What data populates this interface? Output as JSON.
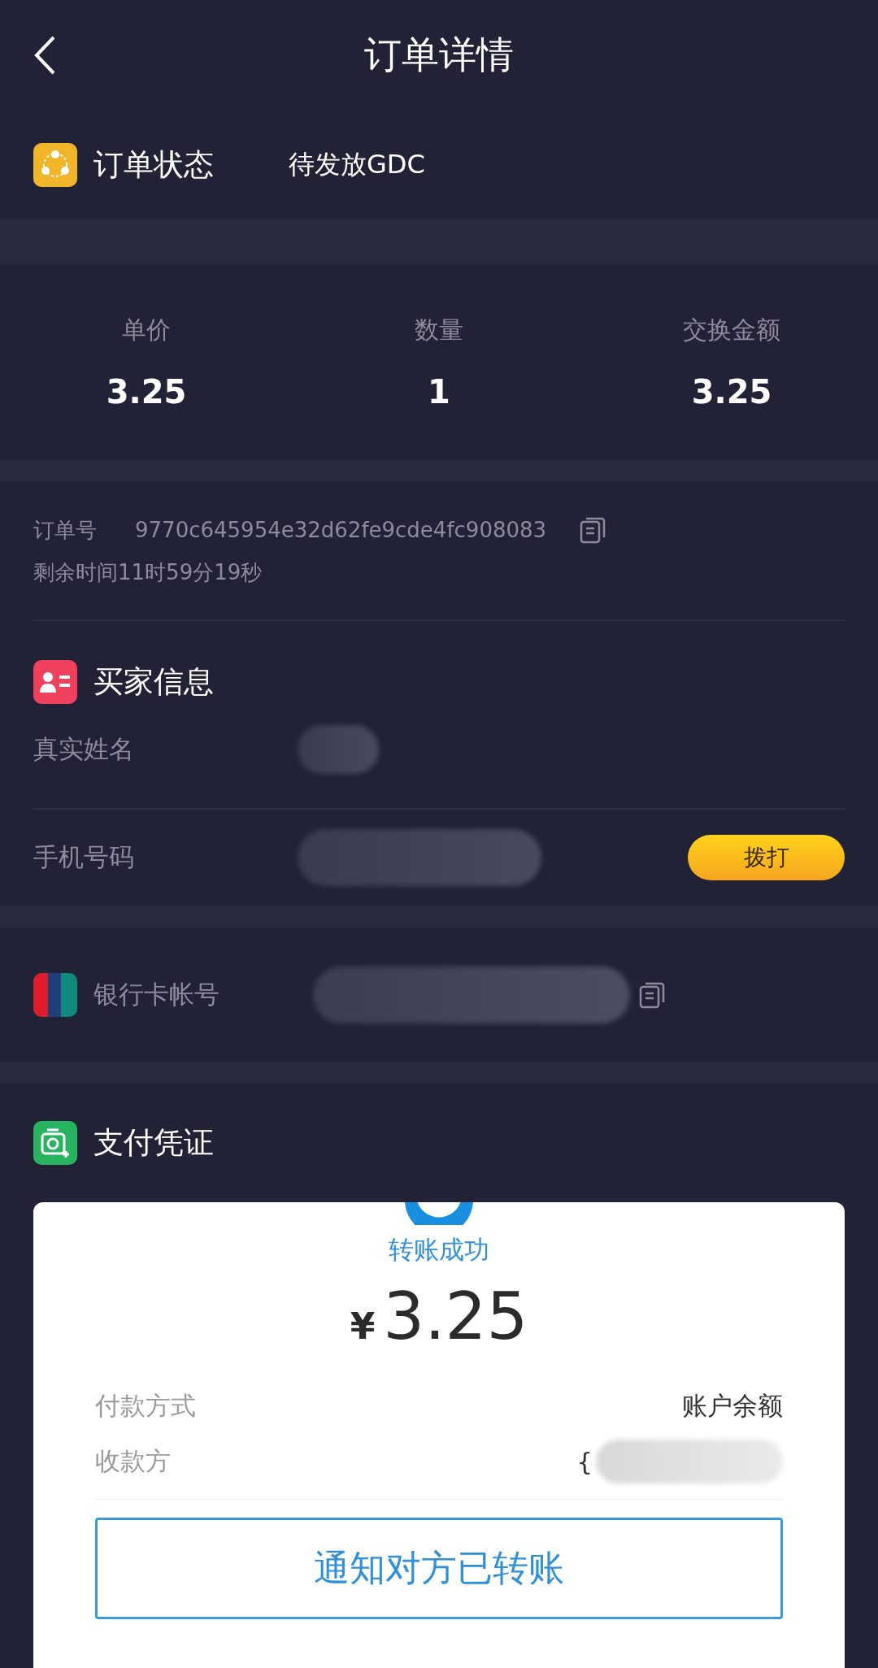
{
  "header": {
    "title": "订单详情"
  },
  "status": {
    "label": "订单状态",
    "value": "待发放GDC"
  },
  "stats": [
    {
      "label": "单价",
      "value": "3.25"
    },
    {
      "label": "数量",
      "value": "1"
    },
    {
      "label": "交换金额",
      "value": "3.25"
    }
  ],
  "order": {
    "number_label": "订单号",
    "number": "9770c645954e32d62fe9cde4fc908083",
    "remaining": "剩余时间11时59分19秒"
  },
  "buyer": {
    "title": "买家信息",
    "fields": [
      {
        "label": "真实姓名",
        "kind": "text"
      },
      {
        "label": "手机号码",
        "kind": "phone",
        "action": "拨打"
      }
    ]
  },
  "bank": {
    "label": "银行卡帐号"
  },
  "proof": {
    "title": "支付凭证",
    "receipt": {
      "status": "转账成功",
      "currency": "¥",
      "amount": "3.25",
      "rows": [
        {
          "label": "付款方式",
          "value": "账户余额"
        },
        {
          "label": "收款方",
          "value": "{"
        }
      ],
      "button": "通知对方已转账"
    }
  }
}
